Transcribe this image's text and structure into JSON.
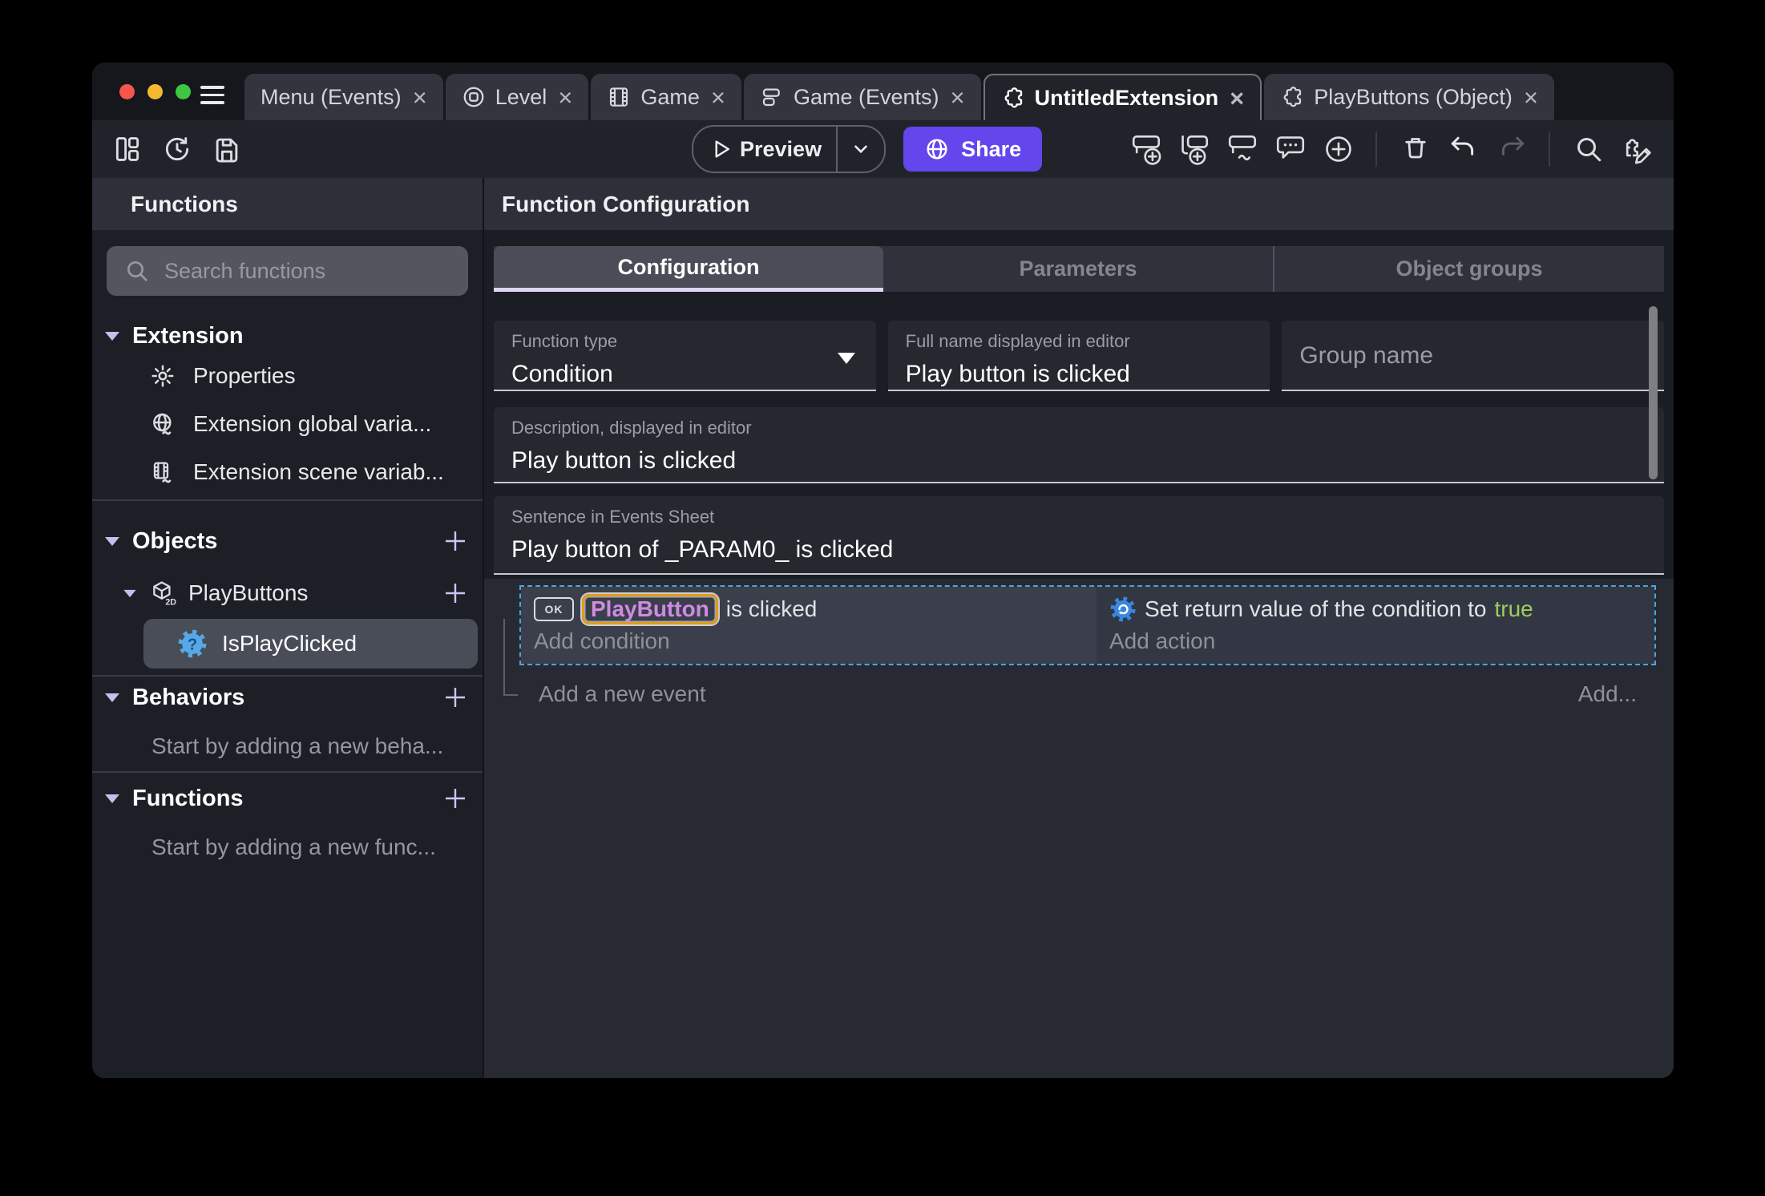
{
  "titlebar": {
    "close_glyph": "×",
    "tabs": [
      {
        "label": "Menu (Events)"
      },
      {
        "label": "Level"
      },
      {
        "label": "Game"
      },
      {
        "label": "Game (Events)"
      },
      {
        "label": "UntitledExtension"
      },
      {
        "label": "PlayButtons (Object)"
      }
    ]
  },
  "toolbar": {
    "preview_label": "Preview",
    "share_label": "Share"
  },
  "sidebar": {
    "title": "Functions",
    "search_placeholder": "Search functions",
    "extension": {
      "label": "Extension",
      "items": [
        "Properties",
        "Extension global varia...",
        "Extension scene variab..."
      ]
    },
    "objects": {
      "label": "Objects",
      "object_name": "PlayButtons",
      "function_name": "IsPlayClicked"
    },
    "behaviors": {
      "label": "Behaviors",
      "empty": "Start by adding a new beha..."
    },
    "functions_section": {
      "label": "Functions",
      "empty": "Start by adding a new func..."
    }
  },
  "main": {
    "title": "Function Configuration",
    "tabs": [
      {
        "label": "Configuration"
      },
      {
        "label": "Parameters"
      },
      {
        "label": "Object groups"
      }
    ],
    "fields": {
      "function_type_label": "Function type",
      "function_type_value": "Condition",
      "full_name_label": "Full name displayed in editor",
      "full_name_value": "Play button is clicked",
      "group_name_placeholder": "Group name",
      "description_label": "Description, displayed in editor",
      "description_value": "Play button is clicked",
      "sentence_label": "Sentence in Events Sheet",
      "sentence_value": "Play button of _PARAM0_ is clicked"
    },
    "events": {
      "ok_icon_text": "OK",
      "condition_object": "PlayButton",
      "condition_suffix": "is clicked",
      "add_condition": "Add condition",
      "action_text": "Set return value of the condition to",
      "action_value": "true",
      "add_action": "Add action",
      "add_new_event": "Add a new event",
      "add_more": "Add..."
    },
    "colors": {
      "accent_purple": "#6346ec",
      "selection_dashed": "#4ba3e3",
      "object_chip_border": "#df9c1d",
      "object_chip_text": "#cf8be2",
      "true_green": "#9ccd5e"
    }
  }
}
